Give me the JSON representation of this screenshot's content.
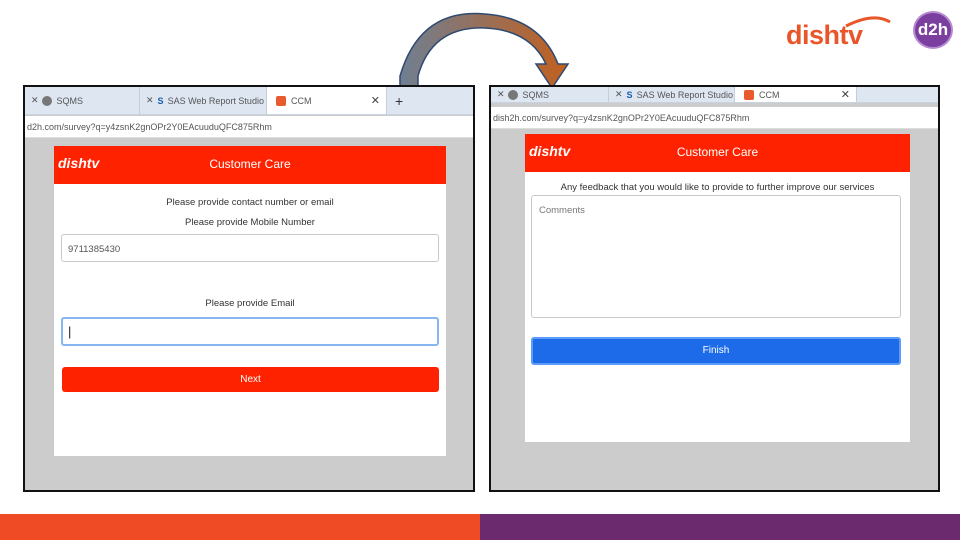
{
  "logos": {
    "dishtv": "dishtv",
    "d2h": "d2h"
  },
  "colors": {
    "brand_red": "#ff2200",
    "finish_blue": "#1d6be8",
    "stripe_orange": "#ef4b25",
    "stripe_purple": "#6c2a6e"
  },
  "left_browser": {
    "tabs": [
      {
        "label": "SQMS",
        "icon": "gear-icon"
      },
      {
        "label": "SAS Web Report Studio : Welcor",
        "icon": "sas-icon"
      },
      {
        "label": "CCM",
        "icon": "page-icon"
      }
    ],
    "new_tab": "+",
    "url": "d2h.com/survey?q=y4zsnK2gnOPr2Y0EAcuuduQFC875Rhm",
    "header": {
      "brand": "dishtv",
      "title": "Customer Care"
    },
    "question1": "Please provide contact number or email",
    "question2": "Please provide Mobile Number",
    "mobile_value": "9711385430",
    "question3": "Please provide Email",
    "email_value": "|",
    "next_label": "Next"
  },
  "right_browser": {
    "tabs": [
      {
        "label": "SQMS",
        "icon": "gear-icon"
      },
      {
        "label": "SAS Web Report Studio : Welcor",
        "icon": "sas-icon"
      },
      {
        "label": "CCM",
        "icon": "page-icon"
      }
    ],
    "url": "dish2h.com/survey?q=y4zsnK2gnOPr2Y0EAcuuduQFC875Rhm",
    "header": {
      "brand": "dishtv",
      "title": "Customer Care"
    },
    "question": "Any feedback that you would like to provide to further improve our services",
    "comments_placeholder": "Comments",
    "finish_label": "Finish"
  }
}
